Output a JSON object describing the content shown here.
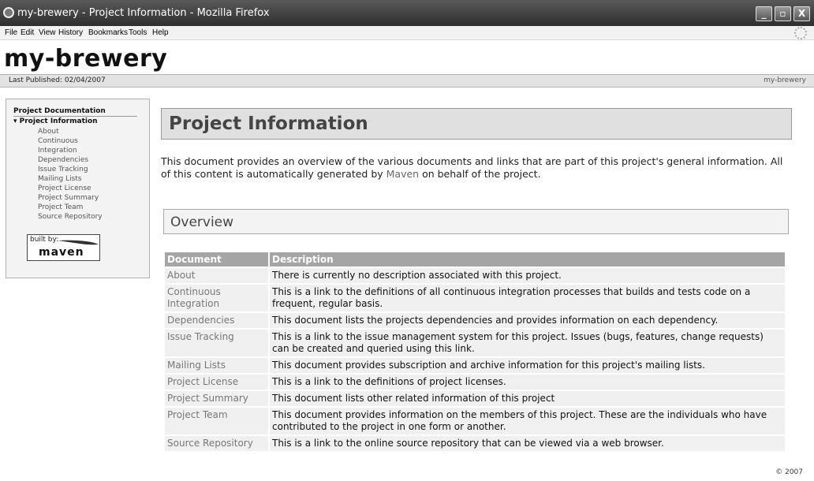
{
  "window": {
    "title": "my-brewery - Project Information - Mozilla Firefox",
    "min_label": "_",
    "max_label": "▫",
    "close_label": "X"
  },
  "menu": {
    "items": [
      "File",
      "Edit",
      "View",
      "History",
      "Bookmarks",
      "Tools",
      "Help"
    ]
  },
  "site": {
    "title": "my-brewery",
    "published": "Last Published: 02/04/2007",
    "breadcrumb_right": "my-brewery"
  },
  "nav": {
    "heading": "Project Documentation",
    "section": "▾ Project Information",
    "items": [
      "About",
      "Continuous Integration",
      "Dependencies",
      "Issue Tracking",
      "Mailing Lists",
      "Project License",
      "Project Summary",
      "Project Team",
      "Source Repository"
    ],
    "badge_built_by": "built by:",
    "badge_maven": "maven"
  },
  "main": {
    "title": "Project Information",
    "intro_before": "This document provides an overview of the various documents and links that are part of this project's general information. All of this content is automatically generated by ",
    "intro_link": "Maven",
    "intro_after": " on behalf of the project.",
    "overview_title": "Overview",
    "table": {
      "headers": [
        "Document",
        "Description"
      ],
      "rows": [
        {
          "doc": "About",
          "desc": "There is currently no description associated with this project."
        },
        {
          "doc": "Continuous Integration",
          "desc": "This is a link to the definitions of all continuous integration processes that builds and tests code on a frequent, regular basis."
        },
        {
          "doc": "Dependencies",
          "desc": "This document lists the projects dependencies and provides information on each dependency."
        },
        {
          "doc": "Issue Tracking",
          "desc": "This is a link to the issue management system for this project. Issues (bugs, features, change requests) can be created and queried using this link."
        },
        {
          "doc": "Mailing Lists",
          "desc": "This document provides subscription and archive information for this project's mailing lists."
        },
        {
          "doc": "Project License",
          "desc": "This is a link to the definitions of project licenses."
        },
        {
          "doc": "Project Summary",
          "desc": "This document lists other related information of this project"
        },
        {
          "doc": "Project Team",
          "desc": "This document provides information on the members of this project. These are the individuals who have contributed to the project in one form or another."
        },
        {
          "doc": "Source Repository",
          "desc": "This is a link to the online source repository that can be viewed via a web browser."
        }
      ]
    }
  },
  "footer": {
    "copyright": "© 2007"
  }
}
